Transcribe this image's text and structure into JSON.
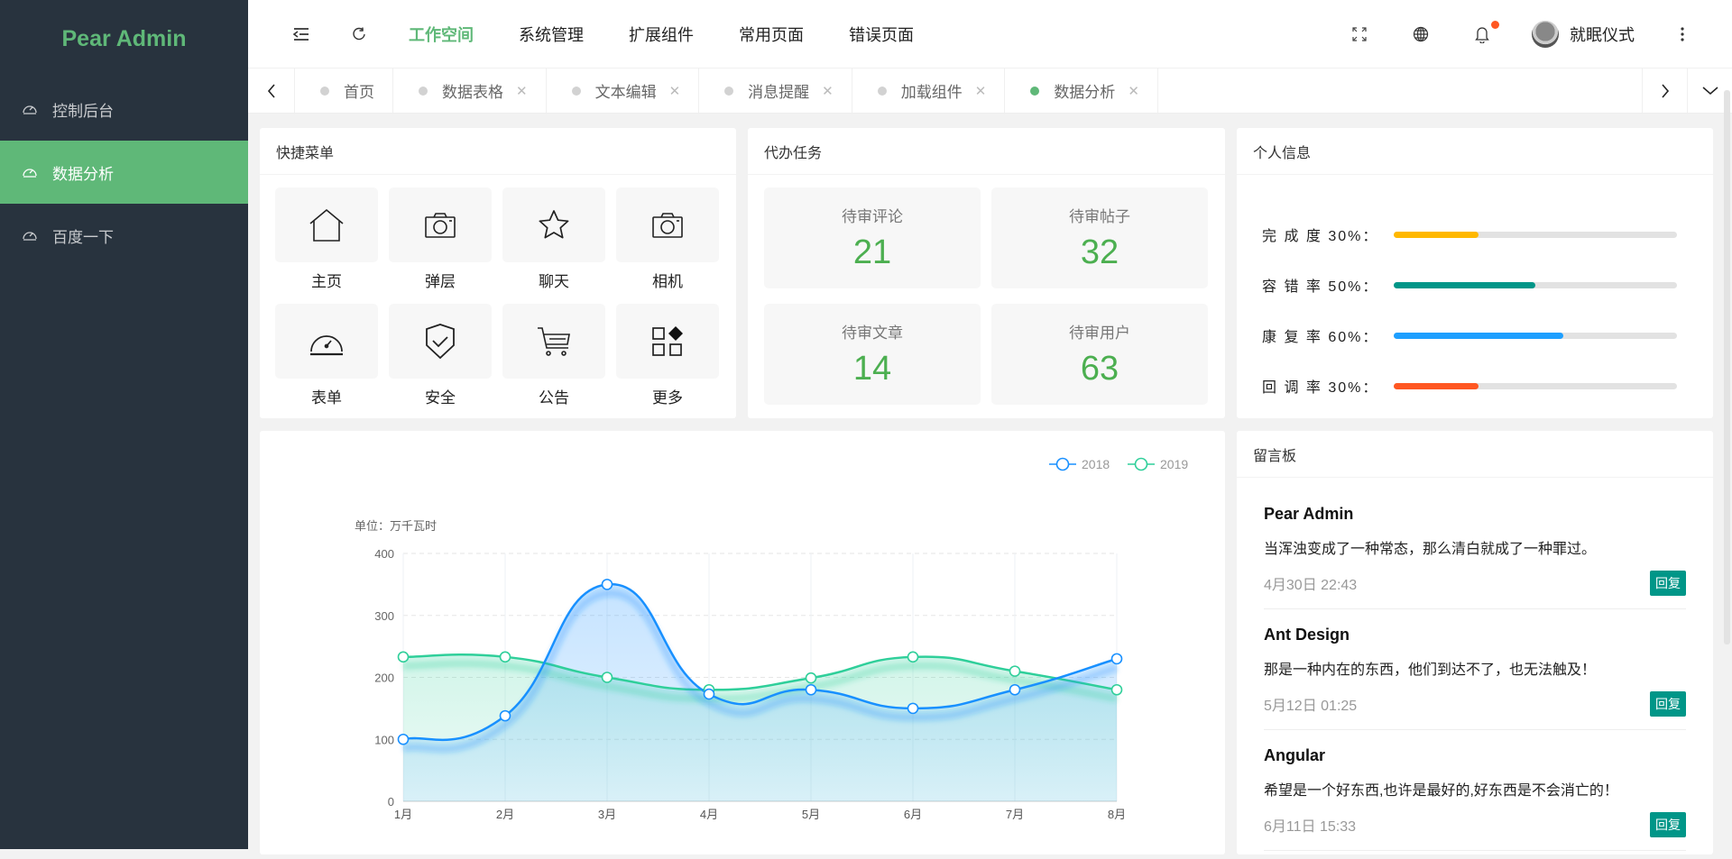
{
  "app": {
    "logo": "Pear Admin",
    "accent": "#5fb878",
    "sidebar_bg": "#28333e"
  },
  "sidebar": {
    "items": [
      {
        "label": "控制后台",
        "icon": "dashboard-icon",
        "active": false
      },
      {
        "label": "数据分析",
        "icon": "dashboard-icon",
        "active": true
      },
      {
        "label": "百度一下",
        "icon": "dashboard-icon",
        "active": false
      }
    ]
  },
  "header": {
    "nav": [
      {
        "label": "工作空间",
        "active": true
      },
      {
        "label": "系统管理",
        "active": false
      },
      {
        "label": "扩展组件",
        "active": false
      },
      {
        "label": "常用页面",
        "active": false
      },
      {
        "label": "错误页面",
        "active": false
      }
    ],
    "icons": [
      "menu-fold-icon",
      "refresh-icon",
      "fullscreen-icon",
      "globe-icon",
      "bell-icon",
      "more-vertical-icon"
    ],
    "user_name": "就眠仪式",
    "notification_dot_color": "#ff5722"
  },
  "tabs": [
    {
      "label": "首页",
      "closable": false,
      "active": false
    },
    {
      "label": "数据表格",
      "closable": true,
      "active": false
    },
    {
      "label": "文本编辑",
      "closable": true,
      "active": false
    },
    {
      "label": "消息提醒",
      "closable": true,
      "active": false
    },
    {
      "label": "加载组件",
      "closable": true,
      "active": false
    },
    {
      "label": "数据分析",
      "closable": true,
      "active": true
    }
  ],
  "tab_close_glyph": "✕",
  "quick_menu": {
    "title": "快捷菜单",
    "items": [
      {
        "label": "主页",
        "icon": "home-icon"
      },
      {
        "label": "弹层",
        "icon": "camera-icon"
      },
      {
        "label": "聊天",
        "icon": "star-icon"
      },
      {
        "label": "相机",
        "icon": "camera-icon"
      },
      {
        "label": "表单",
        "icon": "gauge-icon"
      },
      {
        "label": "安全",
        "icon": "shield-check-icon"
      },
      {
        "label": "公告",
        "icon": "cart-icon"
      },
      {
        "label": "更多",
        "icon": "apps-icon"
      }
    ]
  },
  "todo": {
    "title": "代办任务",
    "items": [
      {
        "label": "待审评论",
        "value": "21"
      },
      {
        "label": "待审帖子",
        "value": "32"
      },
      {
        "label": "待审文章",
        "value": "14"
      },
      {
        "label": "待审用户",
        "value": "63"
      }
    ],
    "value_color": "#4caf50"
  },
  "profile": {
    "title": "个人信息",
    "bars": [
      {
        "label": "完 成 度 30%：",
        "percent": 30,
        "color": "#ffb800"
      },
      {
        "label": "容 错 率 50%：",
        "percent": 50,
        "color": "#009688"
      },
      {
        "label": "康 复 率 60%：",
        "percent": 60,
        "color": "#1e9fff"
      },
      {
        "label": "回 调 率 30%：",
        "percent": 30,
        "color": "#ff5722"
      }
    ]
  },
  "board": {
    "title": "留言板",
    "reply_label": "回复",
    "messages": [
      {
        "author": "Pear Admin",
        "text": "当浑浊变成了一种常态，那么清白就成了一种罪过。",
        "time": "4月30日 22:43"
      },
      {
        "author": "Ant Design",
        "text": "那是一种内在的东西，他们到达不了，也无法触及！",
        "time": "5月12日 01:25"
      },
      {
        "author": "Angular",
        "text": "希望是一个好东西,也许是最好的,好东西是不会消亡的！",
        "time": "6月11日 15:33"
      }
    ]
  },
  "chart_data": {
    "type": "line",
    "smooth": true,
    "area": true,
    "title": "",
    "unit_label": "单位：万千瓦时",
    "xlabel": "",
    "ylabel": "单位：万千瓦时",
    "categories": [
      "1月",
      "2月",
      "3月",
      "4月",
      "5月",
      "6月",
      "7月",
      "8月"
    ],
    "ylim": [
      0,
      400
    ],
    "yticks": [
      0,
      100,
      200,
      300,
      400
    ],
    "grid": true,
    "legend_position": "top-right",
    "series": [
      {
        "name": "2018",
        "color": "#1890ff",
        "values": [
          100,
          138,
          350,
          173,
          180,
          150,
          180,
          230
        ]
      },
      {
        "name": "2019",
        "color": "#2fcf9a",
        "values": [
          233,
          233,
          200,
          180,
          199,
          233,
          210,
          180
        ]
      }
    ]
  }
}
